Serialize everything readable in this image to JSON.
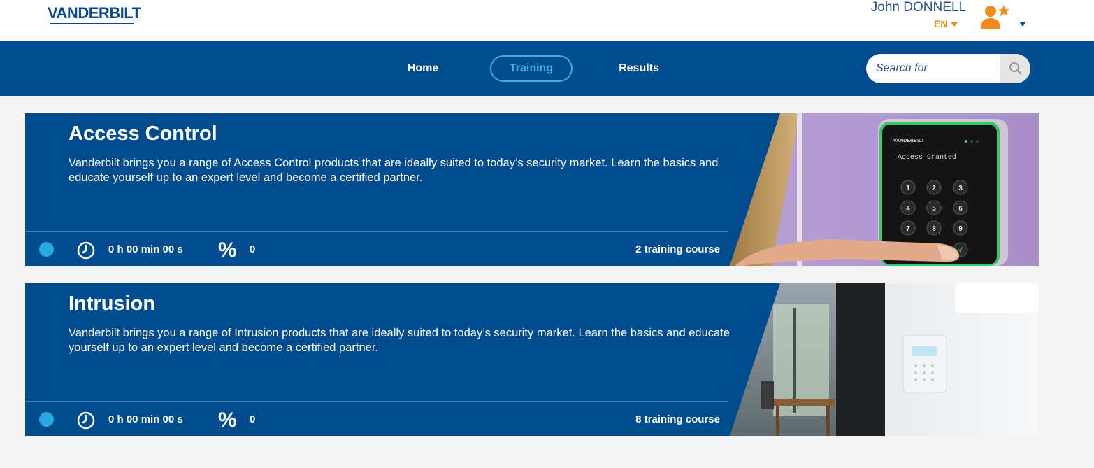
{
  "brand": {
    "logo_text": "VANDERBILT"
  },
  "user": {
    "name": "John DONNELL",
    "language": "EN"
  },
  "nav": {
    "home": "Home",
    "training": "Training",
    "results": "Results"
  },
  "search": {
    "placeholder": "Search for"
  },
  "colors": {
    "primary": "#004c8f",
    "accent": "#3fb0e8",
    "orange": "#f08c1e",
    "status_dot": "#29aae3"
  },
  "cards": [
    {
      "title": "Access Control",
      "description": "Vanderbilt brings you a range of Access Control products that are ideally suited to today’s security market. Learn the basics and educate yourself up to an expert level and become a certified partner.",
      "time": "0 h 00 min 00 s",
      "percent_icon": "%",
      "percent": "0",
      "courses": "2 training course",
      "image_label": "Access Granted",
      "keypad_brand": "VANDERBILT",
      "keypad_keys": [
        "1",
        "2",
        "3",
        "4",
        "5",
        "6",
        "7",
        "8",
        "9",
        "√"
      ]
    },
    {
      "title": "Intrusion",
      "description": "Vanderbilt brings you a range of Intrusion products that are ideally suited to today’s security market. Learn the basics and educate yourself up to an expert level and become a certified partner.",
      "time": "0 h 00 min 00 s",
      "percent_icon": "%",
      "percent": "0",
      "courses": "8 training course"
    }
  ]
}
